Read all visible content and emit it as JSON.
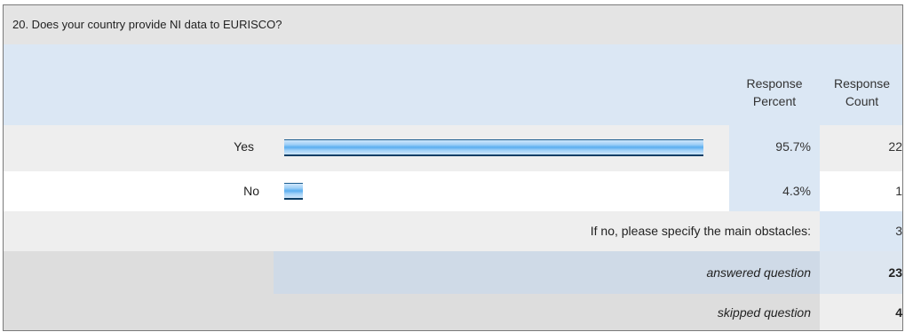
{
  "question": {
    "title": "20. Does your country provide NI data to EURISCO?"
  },
  "columns": {
    "response_percent": "Response\nPercent",
    "response_count": "Response\nCount"
  },
  "rows": [
    {
      "label": "Yes",
      "percent": "95.7%",
      "count": "22",
      "bar_fraction": 0.957
    },
    {
      "label": "No",
      "percent": "4.3%",
      "count": "1",
      "bar_fraction": 0.043
    }
  ],
  "other": {
    "label": "If no, please specify the main obstacles:",
    "count": "3"
  },
  "summary": {
    "answered_label": "answered question",
    "answered_count": "23",
    "skipped_label": "skipped question",
    "skipped_count": "4"
  },
  "colors": {
    "title_bg": "#e4e4e4",
    "header_bg": "#dbe7f4",
    "stat_col_bg": "#dbe7f4",
    "row_bg": "#eeeeee",
    "summary_bg": "#cfdae7",
    "summary_count_bg": "#dde6f0",
    "bar_fill": "#5aaef0"
  }
}
